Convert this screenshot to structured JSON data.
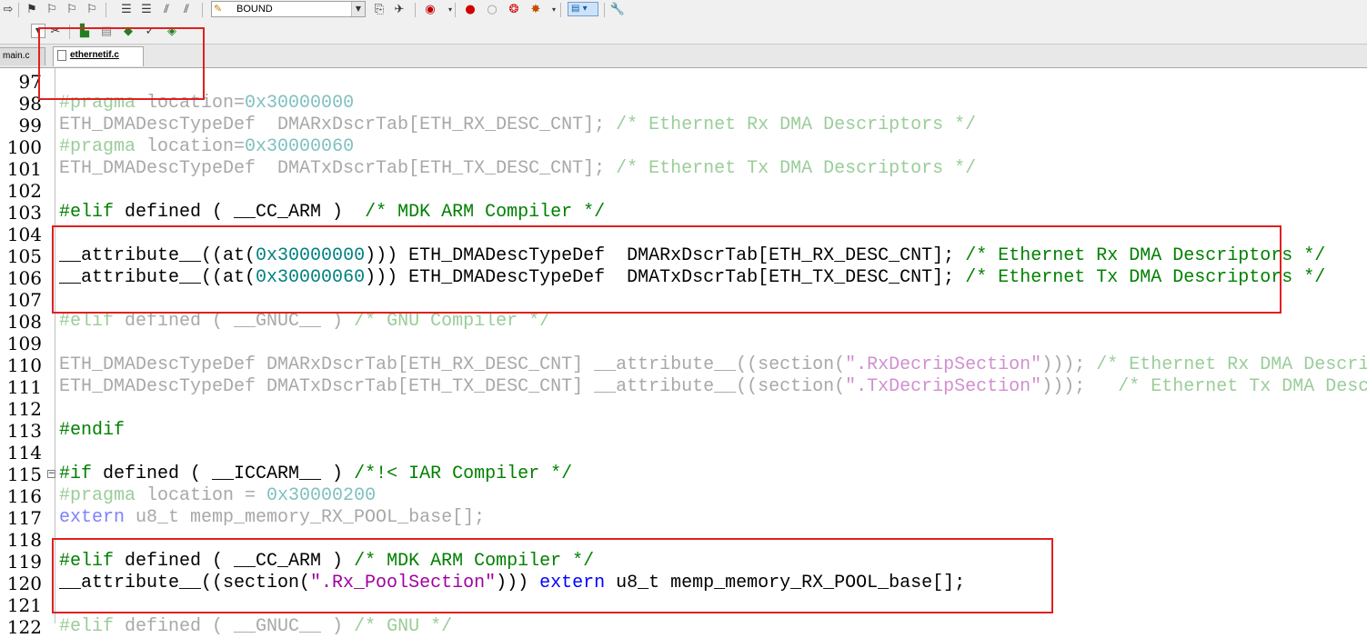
{
  "toolbar": {
    "target_value": "BOUND"
  },
  "tabs": [
    {
      "label": "main.c",
      "active": false
    },
    {
      "label": "ethernetif.c",
      "active": true
    }
  ],
  "lines": [
    {
      "n": "97",
      "parts": [],
      "dim": false
    },
    {
      "n": "98",
      "dim": true,
      "parts": [
        {
          "t": "#pragma",
          "c": "pp"
        },
        {
          "t": " location=",
          "c": ""
        },
        {
          "t": "0x30000000",
          "c": "num"
        }
      ]
    },
    {
      "n": "99",
      "dim": true,
      "parts": [
        {
          "t": "ETH_DMADescTypeDef  DMARxDscrTab[ETH_RX_DESC_CNT]; ",
          "c": ""
        },
        {
          "t": "/* Ethernet Rx DMA Descriptors */",
          "c": "cm"
        }
      ]
    },
    {
      "n": "100",
      "dim": true,
      "parts": [
        {
          "t": "#pragma",
          "c": "pp"
        },
        {
          "t": " location=",
          "c": ""
        },
        {
          "t": "0x30000060",
          "c": "num"
        }
      ]
    },
    {
      "n": "101",
      "dim": true,
      "parts": [
        {
          "t": "ETH_DMADescTypeDef  DMATxDscrTab[ETH_TX_DESC_CNT]; ",
          "c": ""
        },
        {
          "t": "/* Ethernet Tx DMA Descriptors */",
          "c": "cm"
        }
      ]
    },
    {
      "n": "102",
      "dim": false,
      "parts": []
    },
    {
      "n": "103",
      "dim": false,
      "parts": [
        {
          "t": "#elif",
          "c": "pp"
        },
        {
          "t": " defined ( __CC_ARM )  ",
          "c": ""
        },
        {
          "t": "/* MDK ARM Compiler */",
          "c": "cm"
        }
      ]
    },
    {
      "n": "104",
      "dim": false,
      "parts": []
    },
    {
      "n": "105",
      "dim": false,
      "parts": [
        {
          "t": "__attribute__((at(",
          "c": ""
        },
        {
          "t": "0x30000000",
          "c": "num"
        },
        {
          "t": "))) ETH_DMADescTypeDef  DMARxDscrTab[ETH_RX_DESC_CNT]; ",
          "c": ""
        },
        {
          "t": "/* Ethernet Rx DMA Descriptors */",
          "c": "cm"
        }
      ]
    },
    {
      "n": "106",
      "dim": false,
      "parts": [
        {
          "t": "__attribute__((at(",
          "c": ""
        },
        {
          "t": "0x30000060",
          "c": "num"
        },
        {
          "t": "))) ETH_DMADescTypeDef  DMATxDscrTab[ETH_TX_DESC_CNT]; ",
          "c": ""
        },
        {
          "t": "/* Ethernet Tx DMA Descriptors */",
          "c": "cm"
        }
      ]
    },
    {
      "n": "107",
      "dim": false,
      "parts": []
    },
    {
      "n": "108",
      "dim": true,
      "parts": [
        {
          "t": "#elif",
          "c": "pp"
        },
        {
          "t": " defined ( __GNUC__ ) ",
          "c": ""
        },
        {
          "t": "/* GNU Compiler */",
          "c": "cm"
        }
      ]
    },
    {
      "n": "109",
      "dim": true,
      "parts": []
    },
    {
      "n": "110",
      "dim": true,
      "parts": [
        {
          "t": "ETH_DMADescTypeDef DMARxDscrTab[ETH_RX_DESC_CNT] __attribute__((section(",
          "c": ""
        },
        {
          "t": "\".RxDecripSection\"",
          "c": "str"
        },
        {
          "t": "))); ",
          "c": ""
        },
        {
          "t": "/* Ethernet Rx DMA Descri",
          "c": "cm"
        }
      ]
    },
    {
      "n": "111",
      "dim": true,
      "parts": [
        {
          "t": "ETH_DMADescTypeDef DMATxDscrTab[ETH_TX_DESC_CNT] __attribute__((section(",
          "c": ""
        },
        {
          "t": "\".TxDecripSection\"",
          "c": "str"
        },
        {
          "t": ")));   ",
          "c": ""
        },
        {
          "t": "/* Ethernet Tx DMA Desc",
          "c": "cm"
        }
      ]
    },
    {
      "n": "112",
      "dim": false,
      "parts": []
    },
    {
      "n": "113",
      "dim": false,
      "parts": [
        {
          "t": "#endif",
          "c": "pp"
        }
      ]
    },
    {
      "n": "114",
      "dim": false,
      "parts": []
    },
    {
      "n": "115",
      "dim": false,
      "fold": true,
      "parts": [
        {
          "t": "#if",
          "c": "pp"
        },
        {
          "t": " defined ( __ICCARM__ ) ",
          "c": ""
        },
        {
          "t": "/*!< IAR Compiler */",
          "c": "cm"
        }
      ]
    },
    {
      "n": "116",
      "dim": true,
      "parts": [
        {
          "t": "#pragma",
          "c": "pp"
        },
        {
          "t": " location = ",
          "c": ""
        },
        {
          "t": "0x30000200",
          "c": "num"
        }
      ]
    },
    {
      "n": "117",
      "dim": true,
      "parts": [
        {
          "t": "extern",
          "c": "kw"
        },
        {
          "t": " u8_t memp_memory_RX_POOL_base[];",
          "c": ""
        }
      ]
    },
    {
      "n": "118",
      "dim": false,
      "parts": []
    },
    {
      "n": "119",
      "dim": false,
      "parts": [
        {
          "t": "#elif",
          "c": "pp"
        },
        {
          "t": " defined ( __CC_ARM ) ",
          "c": ""
        },
        {
          "t": "/* MDK ARM Compiler */",
          "c": "cm"
        }
      ]
    },
    {
      "n": "120",
      "dim": false,
      "parts": [
        {
          "t": "__attribute__((section(",
          "c": ""
        },
        {
          "t": "\".Rx_PoolSection\"",
          "c": "str"
        },
        {
          "t": "))) ",
          "c": ""
        },
        {
          "t": "extern",
          "c": "kw"
        },
        {
          "t": " u8_t memp_memory_RX_POOL_base[];",
          "c": ""
        }
      ]
    },
    {
      "n": "121",
      "dim": false,
      "parts": []
    },
    {
      "n": "122",
      "dim": true,
      "parts": [
        {
          "t": "#elif",
          "c": "pp"
        },
        {
          "t": " defined ( __GNUC__ ) ",
          "c": ""
        },
        {
          "t": "/* GNU */",
          "c": "cm"
        }
      ]
    }
  ]
}
